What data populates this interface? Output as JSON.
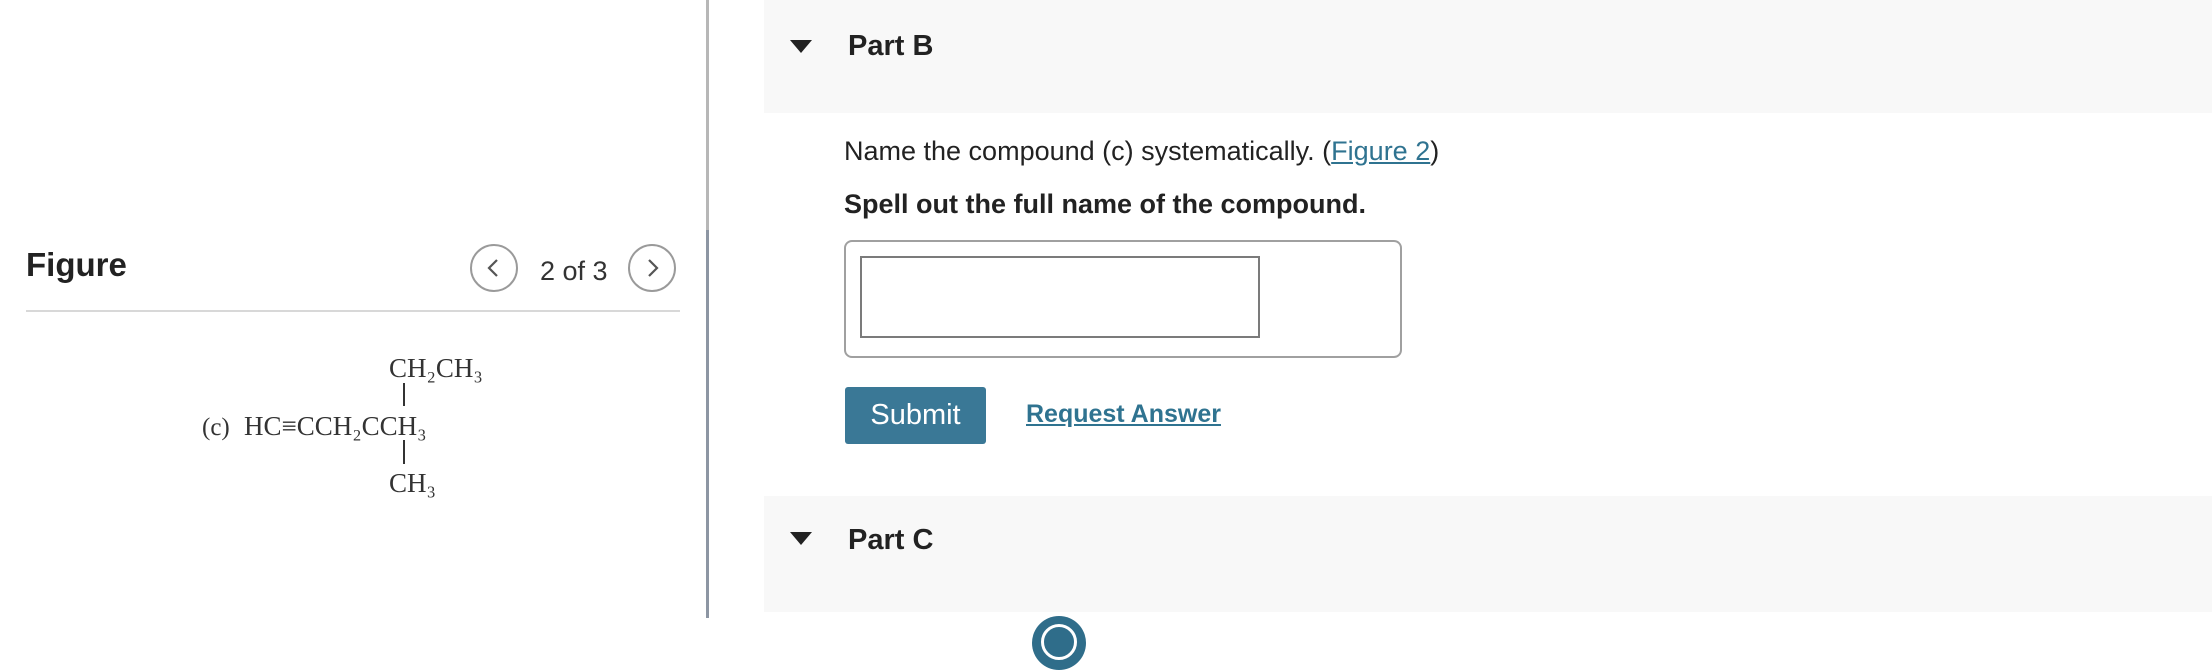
{
  "figure": {
    "title": "Figure",
    "page_indicator": "2 of 3",
    "prev_icon": "chevron-left-icon",
    "next_icon": "chevron-right-icon",
    "compound": {
      "label": "(c)",
      "main_chain": "HC≡CCH₂CCH₃",
      "top_group": "CH₂CH₃",
      "bottom_group": "CH₃"
    }
  },
  "part_b": {
    "title": "Part B",
    "caret_icon": "caret-down-icon",
    "question_prefix": "Name the compound (c) systematically. (",
    "figure_link": "Figure 2",
    "question_suffix": ")",
    "instruction": "Spell out the full name of the compound.",
    "answer_value": "",
    "submit_label": "Submit",
    "request_answer_label": "Request Answer"
  },
  "part_c": {
    "title": "Part C",
    "caret_icon": "caret-down-icon"
  },
  "colors": {
    "accent": "#3a7896",
    "link": "#2f7390",
    "header_bg": "#f8f8f8"
  }
}
